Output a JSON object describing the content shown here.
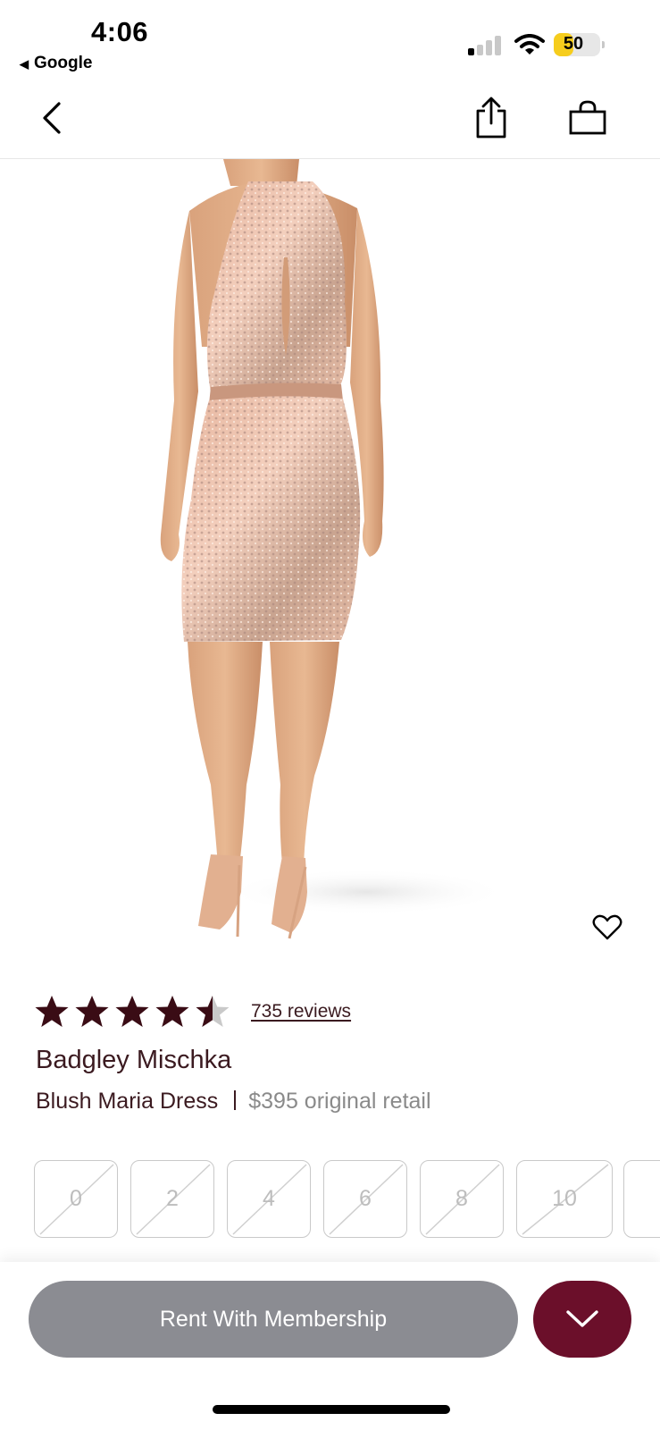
{
  "status_bar": {
    "time": "4:06",
    "back_app": "Google",
    "battery": "50",
    "battery_level": 0.5
  },
  "header": {
    "back_icon": "chevron-left-icon",
    "share_icon": "share-icon",
    "bag_icon": "shopping-bag-icon"
  },
  "product": {
    "rating": 4.5,
    "reviews": "735 reviews",
    "brand": "Badgley Mischka",
    "name": "Blush Maria Dress",
    "retail": "$395 original retail"
  },
  "sizes": [
    {
      "label": "0"
    },
    {
      "label": "2"
    },
    {
      "label": "4"
    },
    {
      "label": "6"
    },
    {
      "label": "8"
    },
    {
      "label": "10"
    }
  ],
  "actions": {
    "rent_label": "Rent With Membership",
    "expand_icon": "chevron-down-icon"
  },
  "colors": {
    "accent": "#6b0f2a",
    "rent_button": "#8b8c92",
    "star": "#3a0c15",
    "battery": "#f6cd1d"
  }
}
